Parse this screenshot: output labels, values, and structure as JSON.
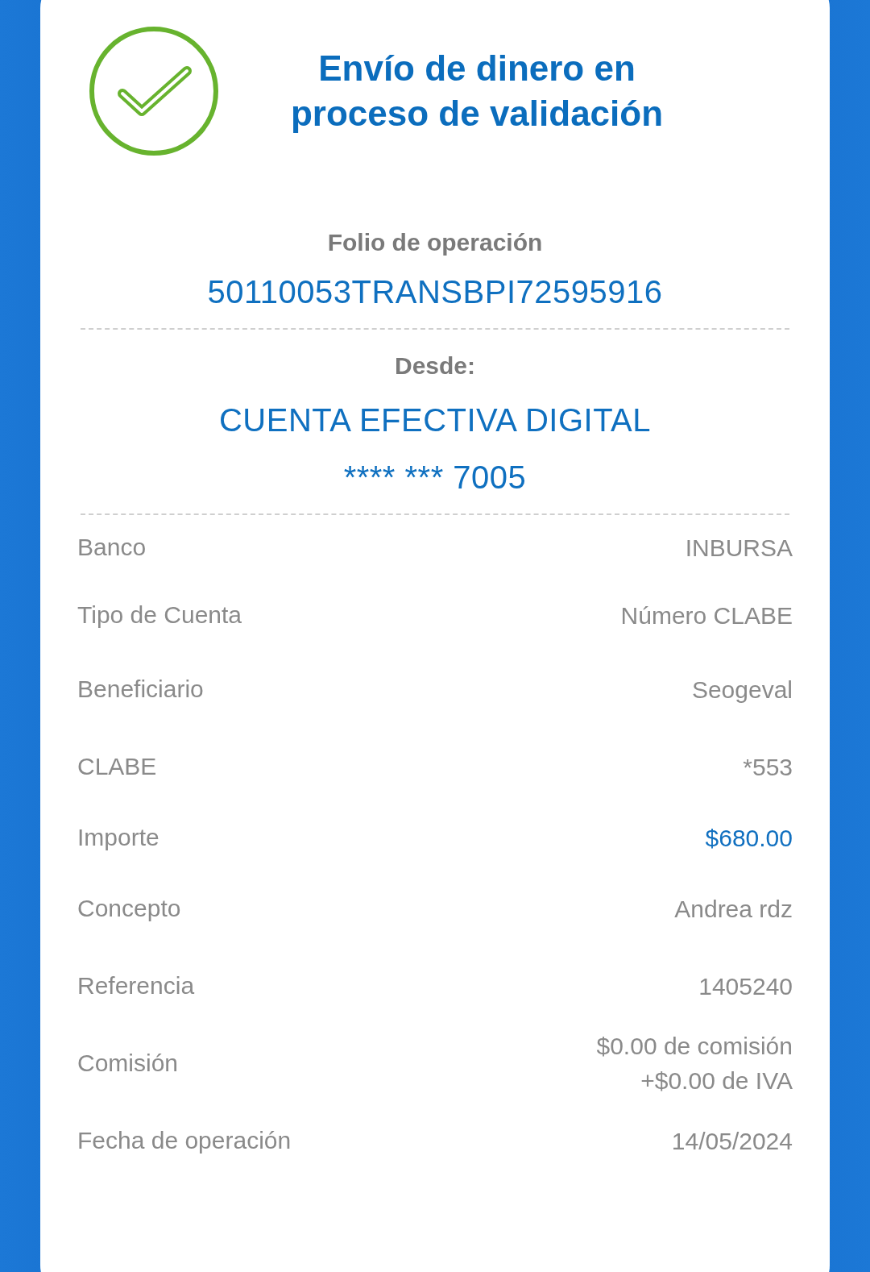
{
  "title": "Envío de dinero en proceso de validación",
  "folio": {
    "label": "Folio de operación",
    "value": "50110053TRANSBPI72595916"
  },
  "origin": {
    "label": "Desde:",
    "account": "CUENTA EFECTIVA DIGITAL",
    "number": "**** *** 7005"
  },
  "details": [
    {
      "label": "Banco",
      "lines": [
        "INBURSA"
      ],
      "highlight": false
    },
    {
      "label": "Tipo de Cuenta",
      "lines": [
        "Número CLABE"
      ],
      "highlight": false
    },
    {
      "label": "Beneficiario",
      "lines": [
        "Seogeval"
      ],
      "highlight": false
    },
    {
      "label": "CLABE",
      "lines": [
        "*553"
      ],
      "highlight": false
    },
    {
      "label": "Importe",
      "lines": [
        "$680.00"
      ],
      "highlight": true
    },
    {
      "label": "Concepto",
      "lines": [
        "Andrea rdz"
      ],
      "highlight": false
    },
    {
      "label": "Referencia",
      "lines": [
        "1405240"
      ],
      "highlight": false
    },
    {
      "label": "Comisión",
      "lines": [
        "$0.00 de comisión",
        "+$0.00 de IVA"
      ],
      "highlight": false
    },
    {
      "label": "Fecha de operación",
      "lines": [
        "14/05/2024"
      ],
      "highlight": false
    }
  ]
}
